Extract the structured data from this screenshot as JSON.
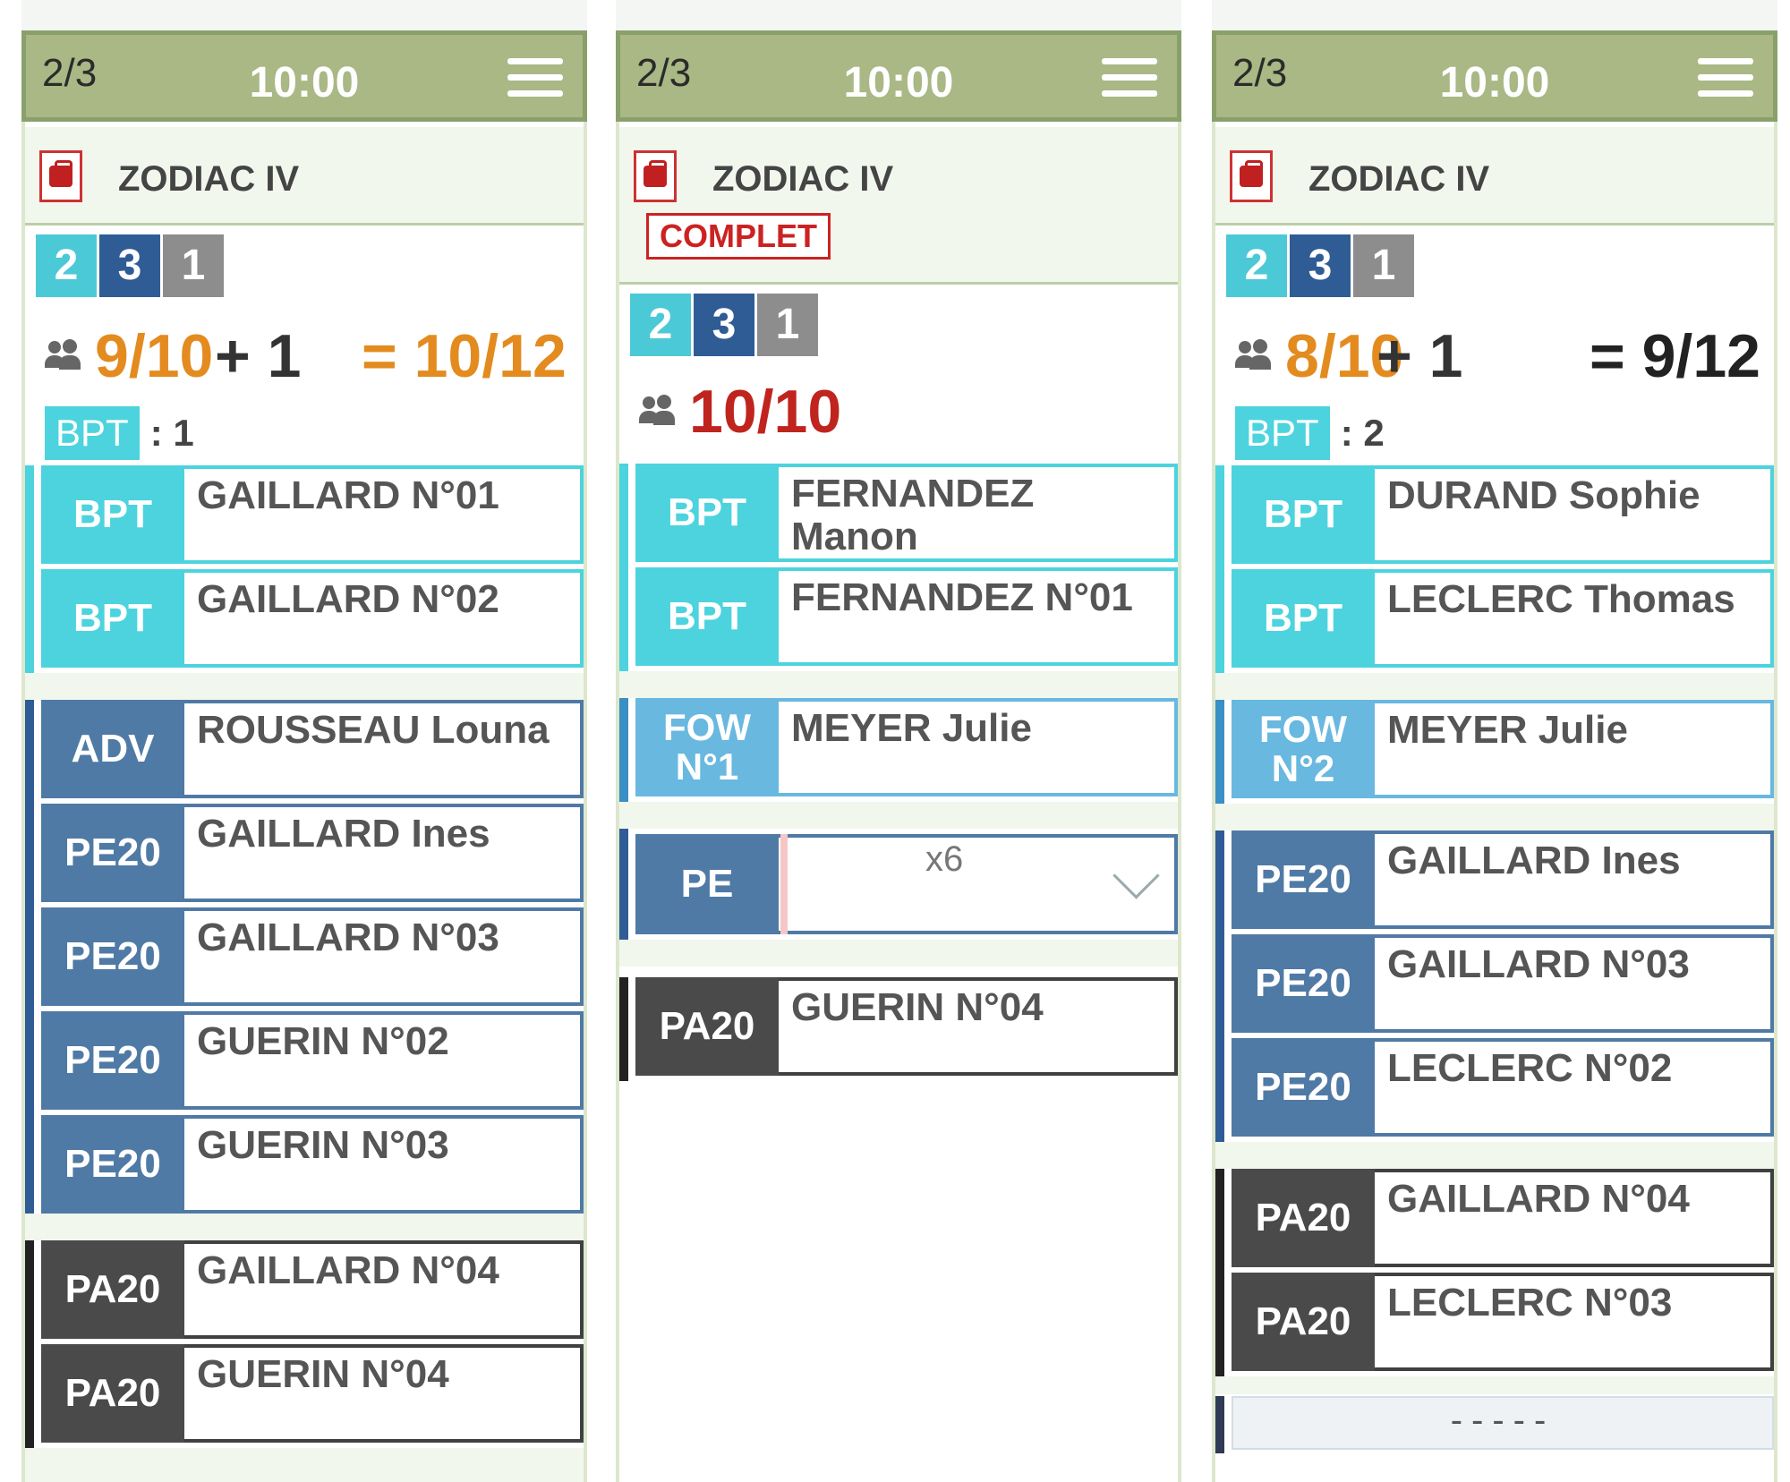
{
  "columns": [
    {
      "dive": "2/3",
      "time": "10:00",
      "boat": "ZODIAC IV",
      "levels": [
        "2",
        "3",
        "1"
      ],
      "divers": "9/10",
      "extra": "+ 1",
      "total": "= 10/12",
      "bpt_label": "BPT",
      "bpt_count": ": 1",
      "groups": [
        {
          "type": "bpt",
          "rows": [
            {
              "tag": "BPT",
              "name": "GAILLARD N°01"
            },
            {
              "tag": "BPT",
              "name": "GAILLARD N°02"
            }
          ]
        },
        {
          "type": "pe",
          "rows": [
            {
              "tag": "ADV",
              "name": "ROUSSEAU Louna"
            },
            {
              "tag": "PE20",
              "name": "GAILLARD Ines"
            },
            {
              "tag": "PE20",
              "name": "GAILLARD N°03"
            },
            {
              "tag": "PE20",
              "name": "GUERIN N°02"
            },
            {
              "tag": "PE20",
              "name": "GUERIN N°03"
            }
          ]
        },
        {
          "type": "pa",
          "rows": [
            {
              "tag": "PA20",
              "name": "GAILLARD N°04"
            },
            {
              "tag": "PA20",
              "name": "GUERIN N°04"
            }
          ]
        }
      ]
    },
    {
      "dive": "2/3",
      "time": "10:00",
      "boat": "ZODIAC IV",
      "status": "COMPLET",
      "levels": [
        "2",
        "3",
        "1"
      ],
      "divers": "10/10",
      "groups": [
        {
          "type": "bpt",
          "rows": [
            {
              "tag": "BPT",
              "name": "FERNANDEZ Manon"
            },
            {
              "tag": "BPT",
              "name": "FERNANDEZ N°01"
            }
          ]
        },
        {
          "type": "fow",
          "rows": [
            {
              "tag": "FOW N°1",
              "name": "MEYER Julie"
            }
          ]
        },
        {
          "type": "pe-select",
          "tag": "PE",
          "count": "x6"
        },
        {
          "type": "pa",
          "rows": [
            {
              "tag": "PA20",
              "name": "GUERIN N°04"
            }
          ]
        }
      ]
    },
    {
      "dive": "2/3",
      "time": "10:00",
      "boat": "ZODIAC IV",
      "levels": [
        "2",
        "3",
        "1"
      ],
      "divers": "8/10",
      "extra": "+ 1",
      "total": "= 9/12",
      "bpt_label": "BPT",
      "bpt_count": ": 2",
      "groups": [
        {
          "type": "bpt",
          "rows": [
            {
              "tag": "BPT",
              "name": "DURAND Sophie"
            },
            {
              "tag": "BPT",
              "name": "LECLERC Thomas"
            }
          ]
        },
        {
          "type": "fow",
          "rows": [
            {
              "tag": "FOW N°2",
              "name": "MEYER Julie"
            }
          ]
        },
        {
          "type": "pe",
          "rows": [
            {
              "tag": "PE20",
              "name": "GAILLARD Ines"
            },
            {
              "tag": "PE20",
              "name": "GAILLARD N°03"
            },
            {
              "tag": "PE20",
              "name": "LECLERC N°02"
            }
          ]
        },
        {
          "type": "pa",
          "rows": [
            {
              "tag": "PA20",
              "name": "GAILLARD N°04"
            },
            {
              "tag": "PA20",
              "name": "LECLERC N°03"
            }
          ]
        },
        {
          "type": "empty",
          "text": "-----"
        }
      ]
    }
  ],
  "colors": {
    "header": "#a9b884",
    "bpt": "#4cd3de",
    "fow": "#68b8e0",
    "pe": "#4f7aa5",
    "pa": "#4a4a4a",
    "orange": "#e38b1f",
    "red": "#c0241e"
  },
  "icons": {
    "menu": "hamburger-icon",
    "boat": "boat-bag-icon",
    "people": "people-icon",
    "dropdown": "chevron-down-icon"
  }
}
